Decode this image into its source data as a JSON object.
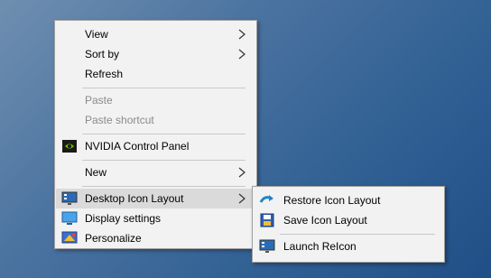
{
  "context_menu": {
    "items": [
      {
        "label": "View"
      },
      {
        "label": "Sort by"
      },
      {
        "label": "Refresh"
      },
      {
        "label": "Paste"
      },
      {
        "label": "Paste shortcut"
      },
      {
        "label": "NVIDIA Control Panel",
        "icon": "nvidia-icon"
      },
      {
        "label": "New"
      },
      {
        "label": "Desktop Icon Layout",
        "icon": "desktop-monitor-icon"
      },
      {
        "label": "Display settings",
        "icon": "display-settings-icon"
      },
      {
        "label": "Personalize",
        "icon": "personalize-icon"
      }
    ]
  },
  "submenu": {
    "items": [
      {
        "label": "Restore Icon Layout",
        "icon": "restore-arrow-icon"
      },
      {
        "label": "Save Icon Layout",
        "icon": "save-floppy-icon"
      },
      {
        "label": "Launch ReIcon",
        "icon": "desktop-monitor-icon"
      }
    ]
  },
  "colors": {
    "menu_background": "#f2f2f2",
    "highlight": "#dadada",
    "disabled_text": "#8a8a8a",
    "nvidia_green": "#76b900",
    "desktop_blue": "#2f5f93"
  }
}
